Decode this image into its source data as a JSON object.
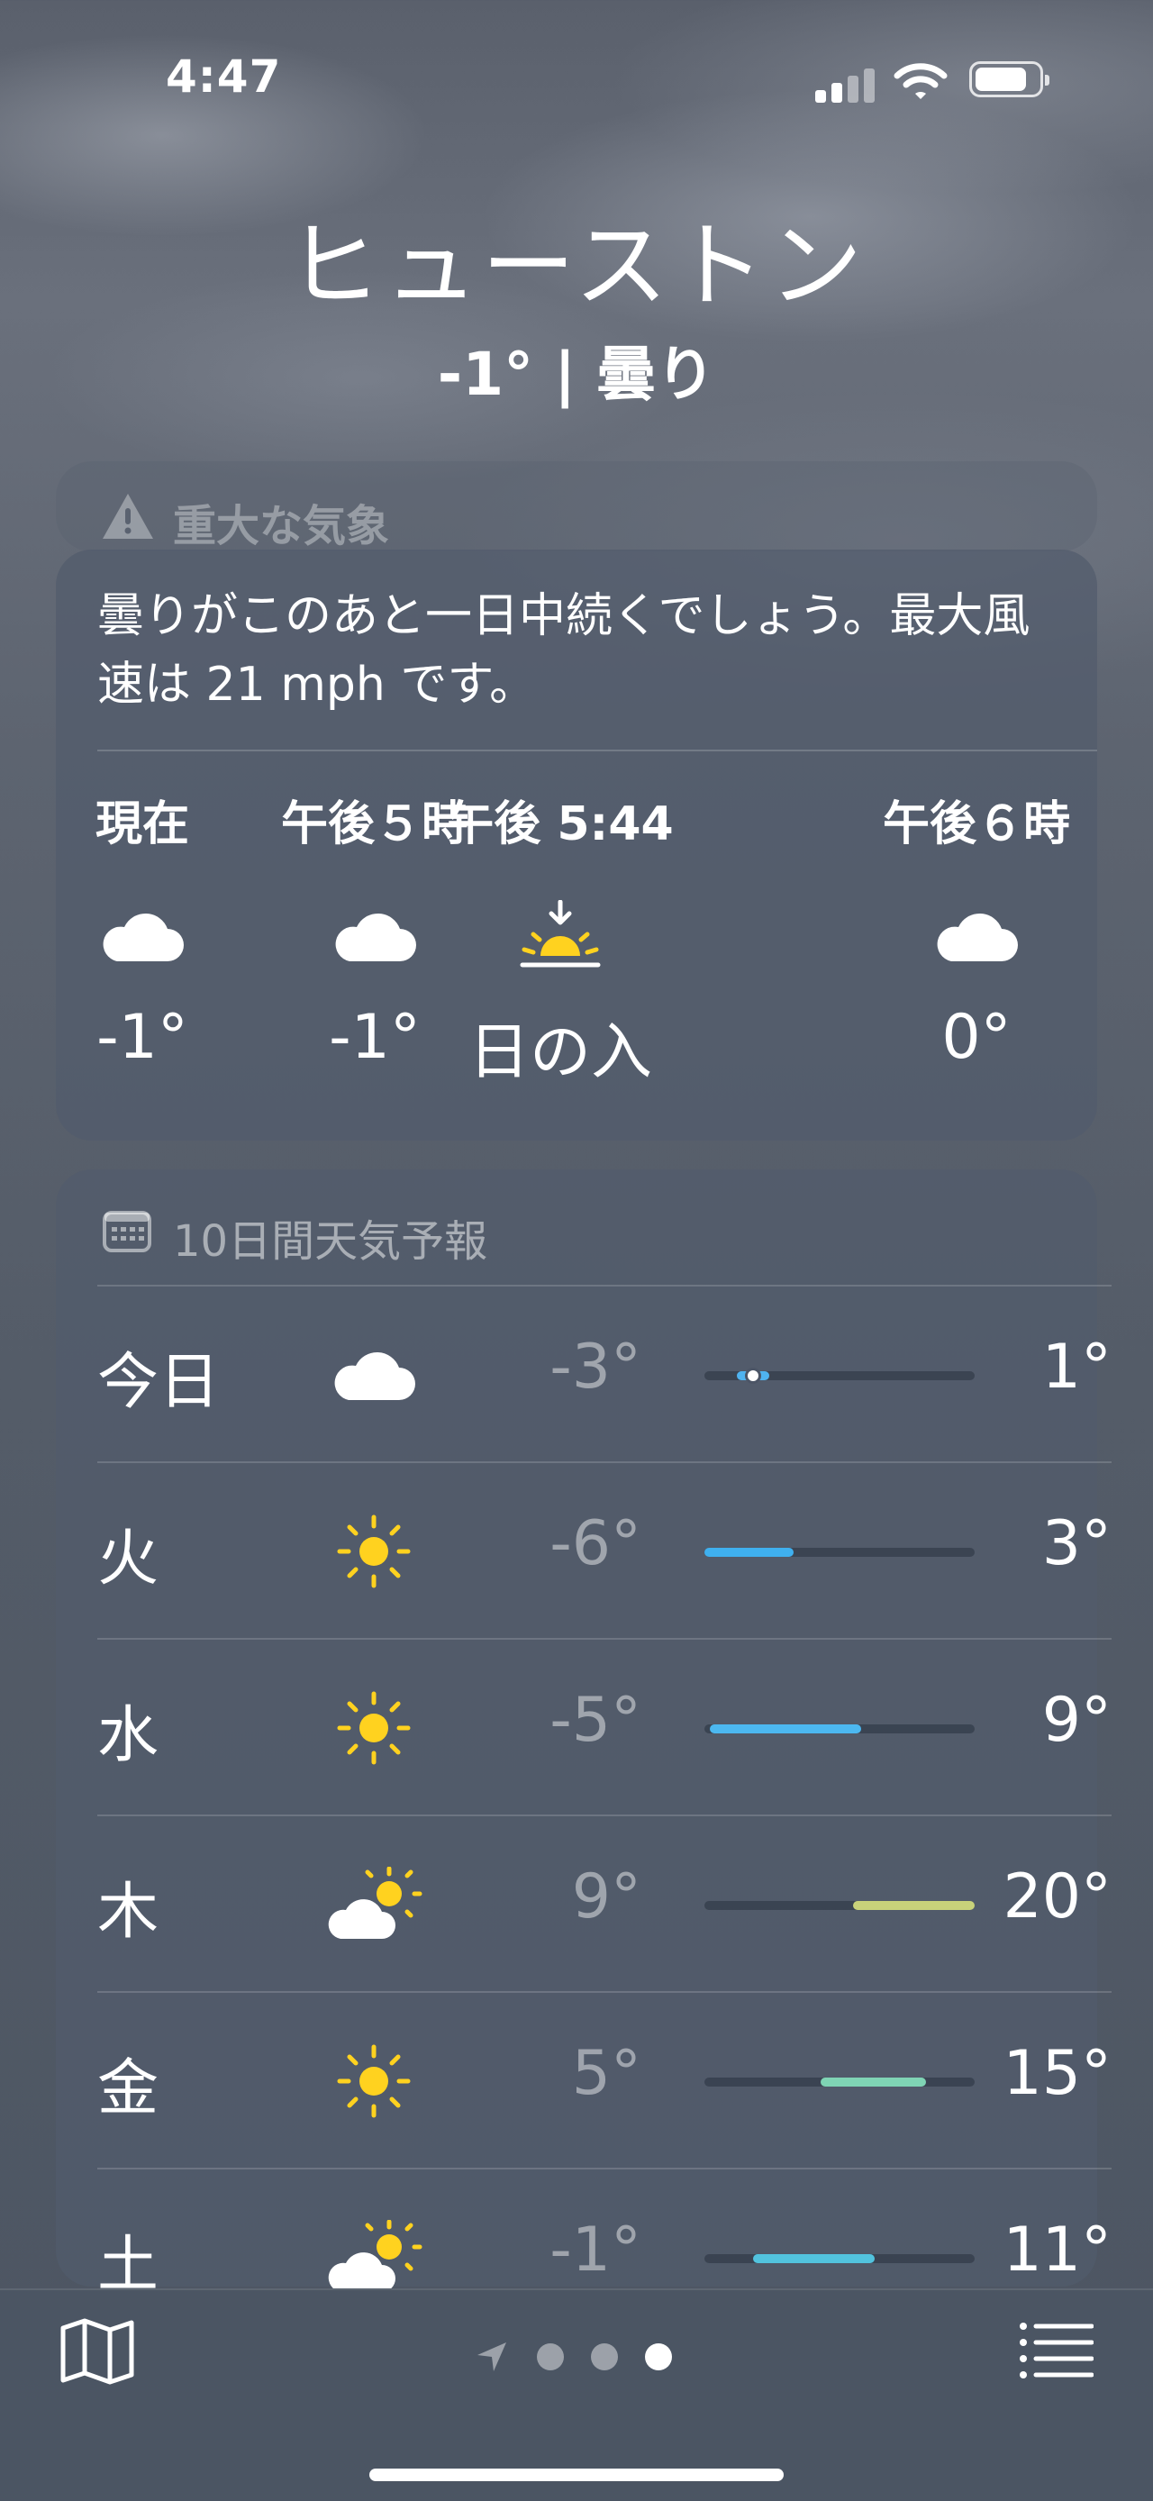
{
  "status_bar": {
    "time": "4:47"
  },
  "location": {
    "city": "ヒューストン",
    "summary": "-1° | 曇り"
  },
  "alert": {
    "label": "重大な気象"
  },
  "hourly": {
    "description": "曇りがこのあと一日中続くでしょう。最大風速は 21 mph です。",
    "items": [
      {
        "label": "現在",
        "icon": "cloud-icon",
        "value": "-1°"
      },
      {
        "label": "午後５時",
        "icon": "cloud-icon",
        "value": "-1°"
      },
      {
        "label": "午後 5:44",
        "icon": "sunset-icon",
        "value": "日の入"
      },
      {
        "label": "午後６時",
        "icon": "cloud-icon",
        "value": "0°"
      }
    ]
  },
  "forecast": {
    "header": "10日間天気予報",
    "days": [
      {
        "day": "今日",
        "icon": "cloud-icon",
        "low": "-3°",
        "high": "1°",
        "range_start": 0.12,
        "range_end": 0.24,
        "bar_color": "#4fb3f0",
        "current_dot": true
      },
      {
        "day": "火",
        "icon": "sun-icon",
        "low": "-6°",
        "high": "3°",
        "range_start": 0.0,
        "range_end": 0.33,
        "bar_color": "#3fb0ef"
      },
      {
        "day": "水",
        "icon": "sun-icon",
        "low": "-5°",
        "high": "9°",
        "range_start": 0.02,
        "range_end": 0.58,
        "bar_color": "#4cb8f0"
      },
      {
        "day": "木",
        "icon": "partly-cloudy-icon",
        "low": "9°",
        "high": "20°",
        "range_start": 0.55,
        "range_end": 1.0,
        "bar_color": "#c8d27a"
      },
      {
        "day": "金",
        "icon": "sun-icon",
        "low": "5°",
        "high": "15°",
        "range_start": 0.43,
        "range_end": 0.82,
        "bar_color": "#7fd4b4"
      },
      {
        "day": "土",
        "icon": "partly-cloudy-icon",
        "low": "-1°",
        "high": "11°",
        "range_start": 0.18,
        "range_end": 0.63,
        "bar_color": "#52c3de"
      }
    ]
  },
  "toolbar": {
    "page_count": 3,
    "active_page": 2
  }
}
